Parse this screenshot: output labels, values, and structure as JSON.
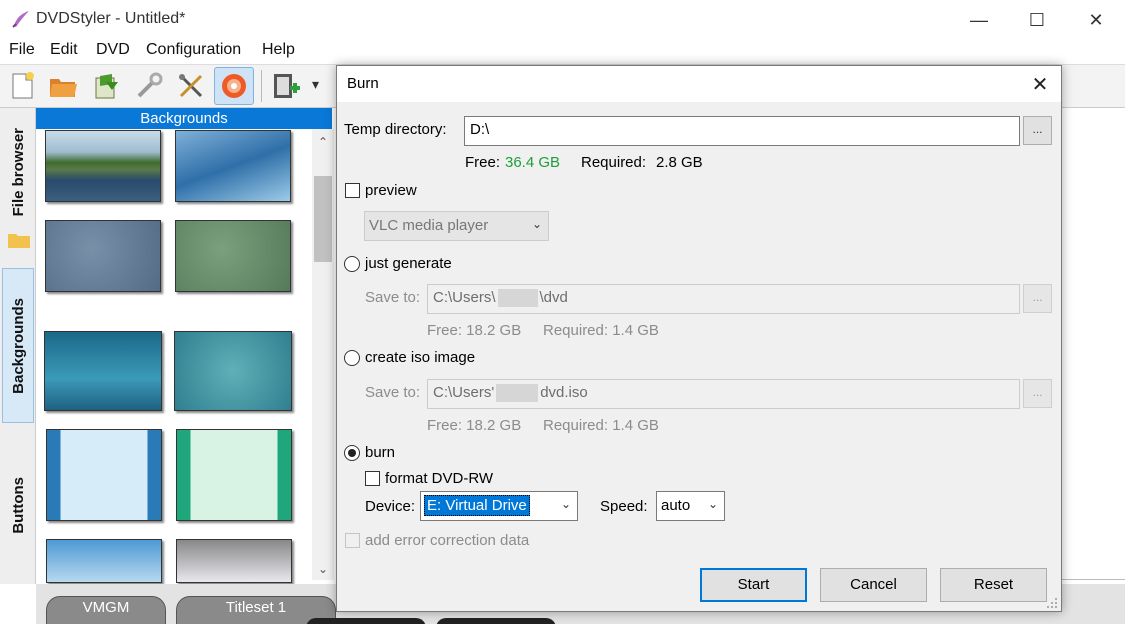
{
  "app": {
    "title": "DVDStyler - Untitled*"
  },
  "window_controls": {
    "minimize": "—",
    "maximize": "☐",
    "close": "✕"
  },
  "menu": [
    "File",
    "Edit",
    "DVD",
    "Configuration",
    "Help"
  ],
  "toolbar": {
    "more": "▾"
  },
  "side_tabs": {
    "file_browser": "File browser",
    "backgrounds": "Backgrounds",
    "buttons": "Buttons"
  },
  "backgrounds_panel": {
    "header": "Backgrounds",
    "scroll_up": "⌃",
    "scroll_down": "⌄"
  },
  "titlesets": {
    "vmgm": "VMGM",
    "titleset1": "Titleset 1"
  },
  "dialog": {
    "title": "Burn",
    "close": "✕",
    "temp_dir": {
      "label": "Temp directory:",
      "value": "D:\\",
      "browse": "...",
      "free_label": "Free:",
      "free_value": "36.4 GB",
      "required_label": "Required:",
      "required_value": "2.8 GB"
    },
    "preview": {
      "label": "preview",
      "player": "VLC media player"
    },
    "just_generate": {
      "label": "just generate",
      "save_to_label": "Save to:",
      "path_start": "C:\\Users\\",
      "path_end": "\\dvd",
      "browse": "...",
      "free_text": "Free: 18.2 GB",
      "required_text": "Required: 1.4 GB"
    },
    "create_iso": {
      "label": "create iso image",
      "save_to_label": "Save to:",
      "path_start": "C:\\Users'",
      "path_end": "dvd.iso",
      "browse": "...",
      "free_text": "Free: 18.2 GB",
      "required_text": "Required: 1.4 GB"
    },
    "burn": {
      "label": "burn",
      "format_label": "format DVD-RW",
      "device_label": "Device:",
      "device_value": "E: Virtual Drive",
      "speed_label": "Speed:",
      "speed_value": "auto"
    },
    "error_correction": "add error correction data",
    "buttons": {
      "start": "Start",
      "cancel": "Cancel",
      "reset": "Reset"
    },
    "chevron": "⌄"
  },
  "colors": {
    "accent": "#0a78d7",
    "free_green": "#1e9e3a"
  }
}
